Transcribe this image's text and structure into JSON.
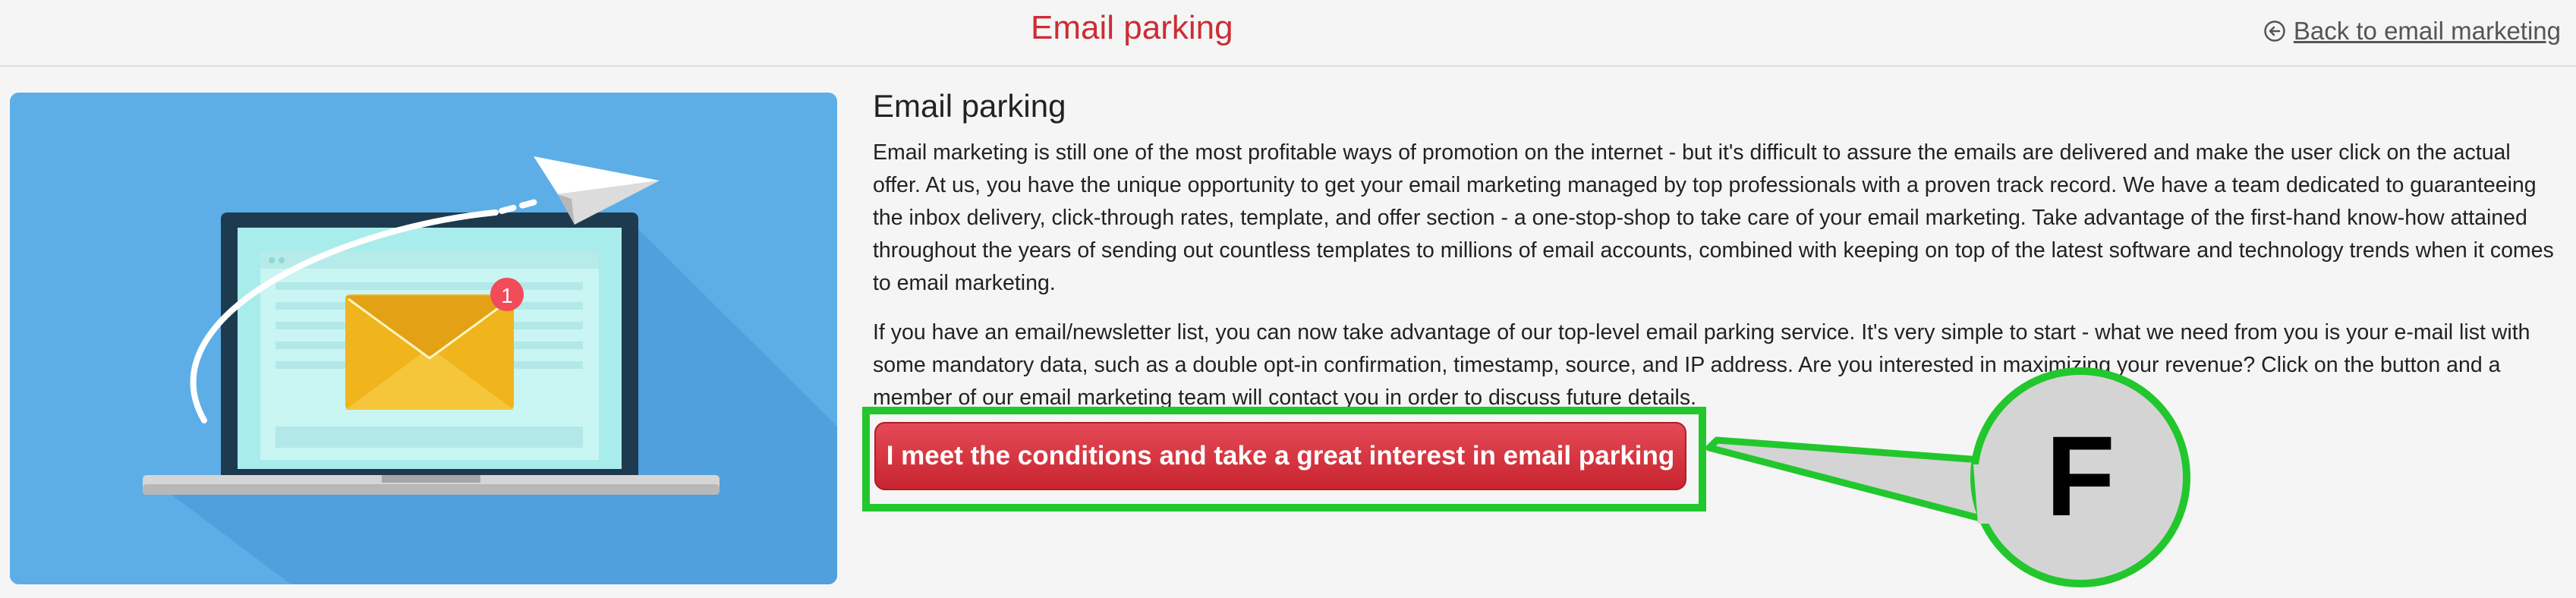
{
  "header": {
    "title": "Email parking",
    "back_link_label": "Back to email marketing",
    "back_icon": "arrow-left-circle-icon"
  },
  "illustration": {
    "icon": "laptop-email-illustration",
    "badge_count": "1"
  },
  "main": {
    "heading": "Email parking",
    "paragraphs": [
      "Email marketing is still one of the most profitable ways of promotion on the internet - but it's difficult to assure the emails are delivered and make the user click on the actual offer. At us, you have the unique opportunity to get your email marketing managed by top professionals with a proven track record. We have a team dedicated to guaranteeing the inbox delivery, click-through rates, template, and offer section - a one-stop-shop to take care of your email marketing. Take advantage of the first-hand know-how attained throughout the years of sending out countless templates to millions of email accounts, combined with keeping on top of the latest software and technology trends when it comes to email marketing.",
      "If you have an email/newsletter list, you can now take advantage of our top-level email parking service. It's very simple to start - what we need from you is your e-mail list with some mandatory data, such as a double opt-in confirmation, timestamp, source, and IP address. Are you interested in maximizing your revenue? Click on the button and a member of our email marketing team will contact you in order to discuss future details."
    ],
    "cta_label": "I meet the conditions and take a great interest in email parking"
  },
  "annotation": {
    "label": "F"
  },
  "colors": {
    "accent": "#cc2d35",
    "highlight": "#22c72d",
    "illustration_bg": "#5daee6"
  }
}
